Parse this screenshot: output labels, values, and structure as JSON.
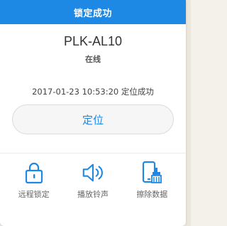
{
  "banner": {
    "title": "锁定成功"
  },
  "device": {
    "name": "PLK-AL10",
    "status": "在线"
  },
  "message": "2017-01-23 10:53:20 定位成功",
  "locate_button": {
    "label": "定位"
  },
  "actions": [
    {
      "label": "远程锁定",
      "icon": "lock-icon"
    },
    {
      "label": "播放铃声",
      "icon": "speaker-icon"
    },
    {
      "label": "擦除数据",
      "icon": "erase-phone-icon"
    }
  ],
  "colors": {
    "accent": "#1e88e5",
    "banner_text": "#ffffff"
  }
}
